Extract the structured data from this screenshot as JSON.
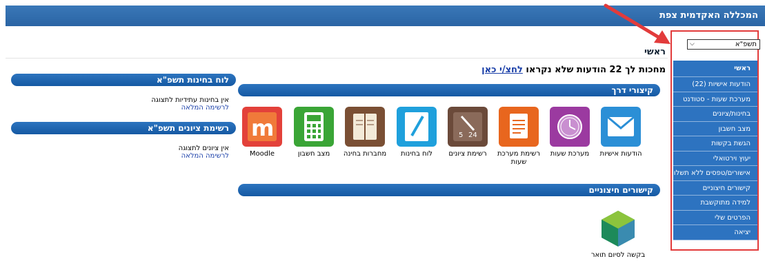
{
  "header": {
    "title": "המכללה האקדמית צפת"
  },
  "breadcrumb": "ראשי",
  "message": {
    "text": "מחכות לך 22 הודעות שלא נקראו",
    "link": "לחצ/י כאן"
  },
  "sidebar": {
    "year_select": "תשפ\"א",
    "items": [
      "ראשי",
      "הודעות אישיות (22)",
      "מערכת שעות - סטודנט",
      "בחינות/ציונים",
      "מצב חשבון",
      "הגשת בקשות",
      "יעוץ וירטואלי",
      "אישורים/טפסים ללא תשלום",
      "קישורים חיצוניים",
      "למידה מתוקשבת",
      "הפרטים שלי",
      "יציאה"
    ]
  },
  "shortcuts": {
    "title": "קיצורי דרך",
    "tiles": [
      {
        "label": "הודעות אישיות",
        "icon": "envelope-icon",
        "color": "#2b8fd6"
      },
      {
        "label": "מערכת שעות",
        "icon": "clock-icon",
        "color": "#9b3aa0"
      },
      {
        "label": "רשימת מערכת שעות",
        "icon": "document-icon",
        "color": "#e8661e"
      },
      {
        "label": "רשימת ציונים",
        "icon": "grades-icon",
        "color": "#6b4a3a"
      },
      {
        "label": "לוח בחינות",
        "icon": "pen-icon",
        "color": "#1fa0dc"
      },
      {
        "label": "מחברות בחינה",
        "icon": "notebook-icon",
        "color": "#7a4f34"
      },
      {
        "label": "מצב חשבון",
        "icon": "calculator-icon",
        "color": "#3aa536"
      },
      {
        "label": "Moodle",
        "icon": "moodle-icon",
        "color": "#e3413a"
      }
    ]
  },
  "external": {
    "title": "קישורים חיצוניים",
    "items": [
      {
        "label": "בקשה לסיום תואר",
        "icon": "hexagon-cube-icon"
      }
    ]
  },
  "exams_panel": {
    "title": "לוח בחינות תשפ\"א",
    "empty": "אין בחינות עתידיות לתצוגה",
    "link": "לרשימה המלאה"
  },
  "grades_panel": {
    "title": "רשימת ציונים תשפ\"א",
    "empty": "אין ציונים לתצוגה",
    "link": "לרשימה המלאה"
  },
  "colors": {
    "header": "#2a64a4",
    "menu": "#2d73c0",
    "highlight": "#e23b3b"
  }
}
